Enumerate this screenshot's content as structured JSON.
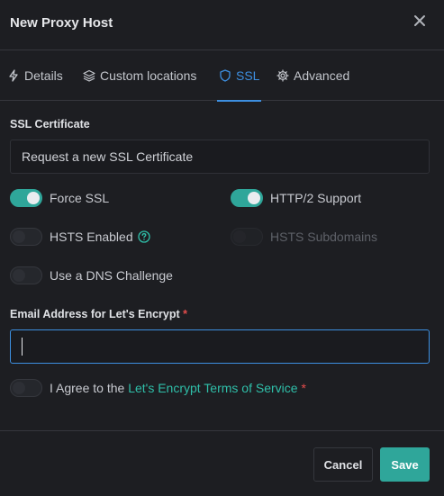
{
  "modal": {
    "title": "New Proxy Host"
  },
  "tabs": [
    {
      "label": "Details",
      "icon": "lightning-icon",
      "active": false
    },
    {
      "label": "Custom locations",
      "icon": "layers-icon",
      "active": false
    },
    {
      "label": "SSL",
      "icon": "shield-icon",
      "active": true
    },
    {
      "label": "Advanced",
      "icon": "gear-icon",
      "active": false
    }
  ],
  "ssl": {
    "certificate_label": "SSL Certificate",
    "certificate_value": "Request a new SSL Certificate",
    "toggles": {
      "force_ssl": {
        "label": "Force SSL",
        "on": true
      },
      "http2": {
        "label": "HTTP/2 Support",
        "on": true
      },
      "hsts": {
        "label": "HSTS Enabled",
        "on": false
      },
      "hsts_sub": {
        "label": "HSTS Subdomains",
        "on": false,
        "disabled": true
      },
      "dns": {
        "label": "Use a DNS Challenge",
        "on": false
      }
    },
    "email_label": "Email Address for Let's Encrypt",
    "required_mark": "*",
    "email_value": "",
    "agree_prefix": "I Agree to the",
    "agree_link": "Let's Encrypt Terms of Service",
    "agree_on": false
  },
  "footer": {
    "cancel_label": "Cancel",
    "save_label": "Save"
  },
  "colors": {
    "accent": "#2fa69a",
    "active_tab": "#3d8fe0",
    "required": "#e44c4c",
    "link": "#2fbfa9"
  }
}
